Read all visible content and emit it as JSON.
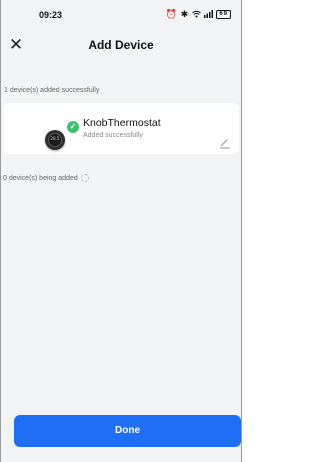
{
  "status_bar": {
    "time": "09:23",
    "icons": [
      "alarm-icon",
      "vibrate-icon",
      "bluetooth-icon",
      "wifi-icon",
      "sim-icon",
      "signal-icon"
    ],
    "battery": "69"
  },
  "header": {
    "title": "Add Device",
    "close_glyph": "✕"
  },
  "added_section": {
    "label": "1 device(s) added successfully"
  },
  "device": {
    "name": "KnobThermostat",
    "status": "Added successfully",
    "readout": "28.5",
    "check_glyph": "✓"
  },
  "adding_section": {
    "label": "0 device(s) being added"
  },
  "footer": {
    "done_label": "Done"
  },
  "colors": {
    "accent": "#1e6ff5",
    "success": "#3cc26b",
    "background": "#f2f3f5"
  }
}
